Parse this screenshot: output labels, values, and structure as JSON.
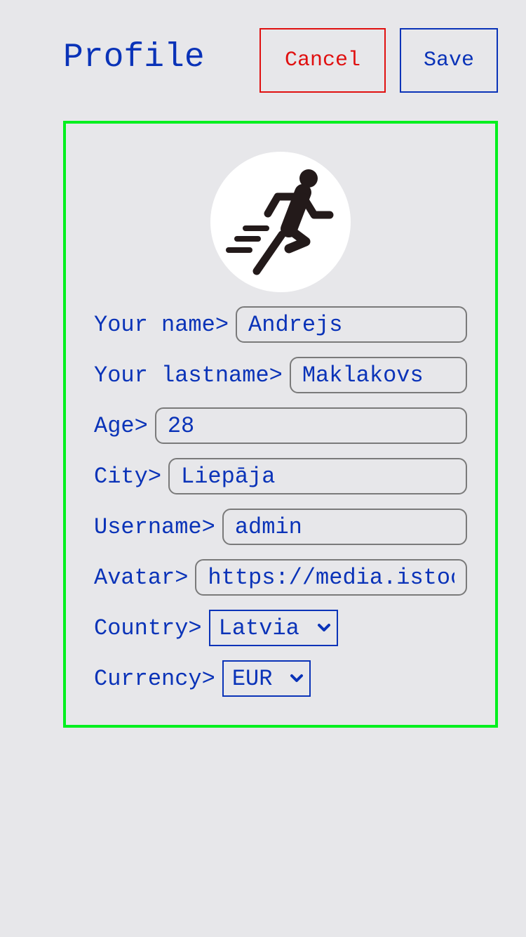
{
  "header": {
    "title": "Profile",
    "cancel_label": "Cancel",
    "save_label": "Save"
  },
  "avatar": {
    "icon": "running-person-icon"
  },
  "form": {
    "name": {
      "label": "Your name>",
      "value": "Andrejs"
    },
    "lastname": {
      "label": "Your lastname>",
      "value": "Maklakovs"
    },
    "age": {
      "label": "Age>",
      "value": "28"
    },
    "city": {
      "label": "City>",
      "value": "Liepāja"
    },
    "username": {
      "label": "Username>",
      "value": "admin"
    },
    "avatar_url": {
      "label": "Avatar>",
      "value": "https://media.istoc"
    },
    "country": {
      "label": "Country>",
      "selected": "Latvia"
    },
    "currency": {
      "label": "Currency>",
      "selected": "EUR"
    }
  },
  "colors": {
    "text": "#0a33b8",
    "cancel": "#e01010",
    "card_border": "#00f01e",
    "background": "#e7e7ea"
  }
}
